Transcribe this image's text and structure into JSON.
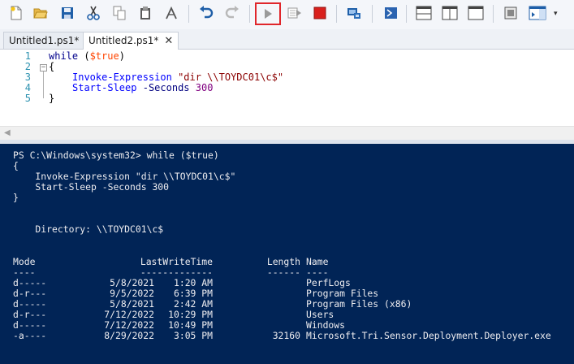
{
  "toolbar": {
    "buttons": [
      {
        "name": "new-file-icon"
      },
      {
        "name": "open-folder-icon"
      },
      {
        "name": "save-icon"
      },
      {
        "name": "cut-icon"
      },
      {
        "name": "copy-icon"
      },
      {
        "name": "paste-icon"
      },
      {
        "name": "clear-icon"
      },
      {
        "name": "undo-icon"
      },
      {
        "name": "redo-icon"
      },
      {
        "name": "run-script-icon"
      },
      {
        "name": "run-selection-icon"
      },
      {
        "name": "stop-icon"
      },
      {
        "name": "remote-powershell-icon"
      },
      {
        "name": "powershell-console-icon"
      },
      {
        "name": "show-script-pane-top-icon"
      },
      {
        "name": "show-script-pane-right-icon"
      },
      {
        "name": "show-script-pane-max-icon"
      },
      {
        "name": "show-command-window-icon"
      },
      {
        "name": "show-command-addon-icon"
      }
    ],
    "colors": {
      "run_highlight": "#e0262b",
      "stop": "#d9201c",
      "accent": "#1f5fa8"
    }
  },
  "tabs": [
    {
      "label": "Untitled1.ps1*",
      "active": false
    },
    {
      "label": "Untitled2.ps1*",
      "active": true,
      "close": "✕"
    }
  ],
  "editor": {
    "line_numbers": [
      "1",
      "2",
      "3",
      "4",
      "5"
    ],
    "lines": {
      "l1_kw": "while",
      "l1_open": " (",
      "l1_var": "$true",
      "l1_close": ")",
      "l2": "{",
      "l3_cmd": "Invoke-Expression",
      "l3_str": "\"dir \\\\TOYDC01\\c$\"",
      "l4_cmd": "Start-Sleep",
      "l4_param": "-Seconds",
      "l4_num": "300",
      "l5": "}"
    }
  },
  "console": {
    "prompt_line": "PS C:\\Windows\\system32> while ($true)",
    "echo": [
      "{",
      "    Invoke-Expression \"dir \\\\TOYDC01\\c$\"",
      "    Start-Sleep -Seconds 300",
      "}"
    ],
    "directory_line": "    Directory: \\\\TOYDC01\\c$",
    "headers": {
      "mode": "Mode",
      "lastwritetime": "LastWriteTime",
      "length": "Length",
      "name": "Name"
    },
    "underlines": {
      "mode": "----",
      "lastwritetime": "-------------",
      "length": "------",
      "name": "----"
    },
    "rows": [
      {
        "mode": "d-----",
        "date": "5/8/2021",
        "time": "1:20 AM",
        "length": "",
        "name": "PerfLogs"
      },
      {
        "mode": "d-r---",
        "date": "9/5/2022",
        "time": "6:39 PM",
        "length": "",
        "name": "Program Files"
      },
      {
        "mode": "d-----",
        "date": "5/8/2021",
        "time": "2:42 AM",
        "length": "",
        "name": "Program Files (x86)"
      },
      {
        "mode": "d-r---",
        "date": "7/12/2022",
        "time": "10:29 PM",
        "length": "",
        "name": "Users"
      },
      {
        "mode": "d-----",
        "date": "7/12/2022",
        "time": "10:49 PM",
        "length": "",
        "name": "Windows"
      },
      {
        "mode": "-a----",
        "date": "8/29/2022",
        "time": "3:05 PM",
        "length": "32160",
        "name": "Microsoft.Tri.Sensor.Deployment.Deployer.exe"
      }
    ]
  }
}
